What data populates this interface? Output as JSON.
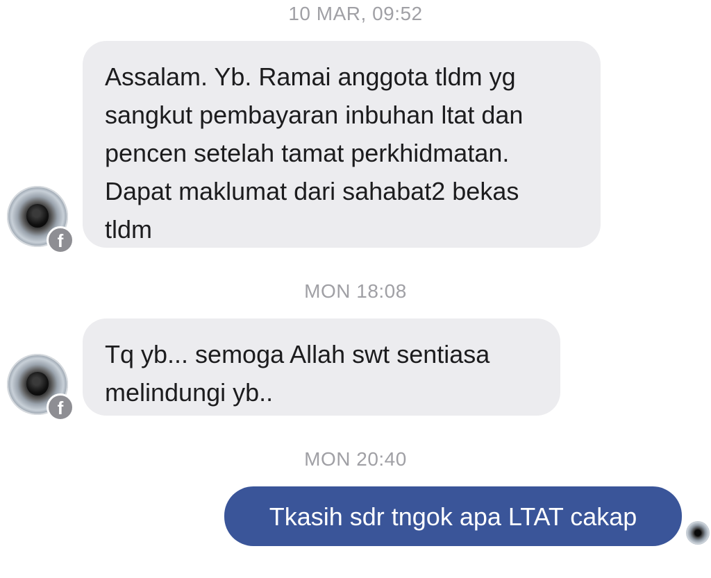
{
  "conversation": {
    "timestamps": [
      "10 MAR, 09:52",
      "MON 18:08",
      "MON 20:40"
    ],
    "messages": [
      {
        "direction": "incoming",
        "lines": [
          "Assalam. Yb. Ramai anggota tldm yg",
          "sangkut pembayaran inbuhan ltat dan",
          "pencen setelah tamat perkhidmatan.",
          "Dapat maklumat dari sahabat2 bekas",
          "tldm"
        ]
      },
      {
        "direction": "incoming",
        "lines": [
          "Tq yb... semoga Allah swt sentiasa",
          "melindungi yb.."
        ]
      },
      {
        "direction": "outgoing",
        "text": "Tkasih sdr tngok apa LTAT cakap"
      }
    ]
  },
  "icons": {
    "badge": "facebook-icon",
    "badge_glyph": "f"
  },
  "colors": {
    "incoming_bubble": "#ececef",
    "outgoing_bubble": "#3a5599",
    "timestamp_text": "#a0a0a5",
    "badge": "#8e8e93"
  }
}
